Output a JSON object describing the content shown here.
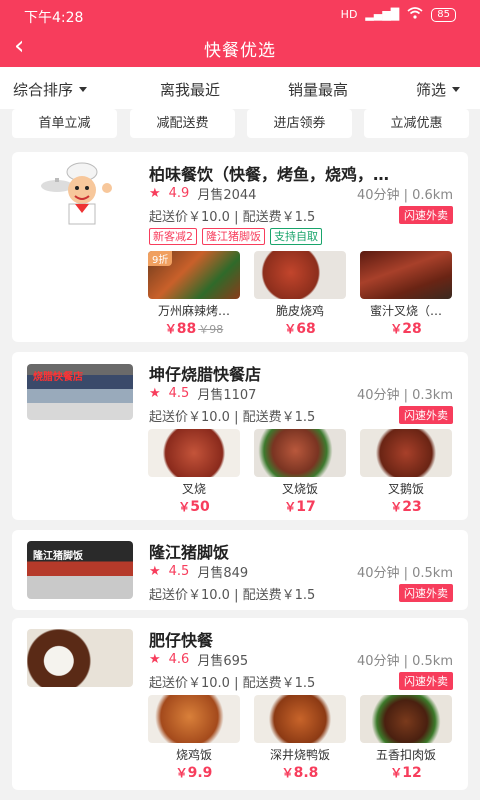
{
  "status": {
    "time": "下午4:28",
    "signal": "HD",
    "battery": "85"
  },
  "nav": {
    "title": "快餐优选"
  },
  "sort": {
    "items": [
      "综合排序",
      "离我最近",
      "销量最高",
      "筛选"
    ]
  },
  "filters": [
    "首单立减",
    "减配送费",
    "进店领券",
    "立减优惠"
  ],
  "colors": {
    "brand": "#f73d5c",
    "green": "#19a46b"
  },
  "shops": [
    {
      "name": "柏味餐饮（快餐，烤鱼，烧鸡，…",
      "rating": "4.9",
      "sales": "月售2044",
      "eta": "40分钟 | 0.6km",
      "fees": "起送价￥10.0 | 配送费￥1.5",
      "flash": "闪速外卖",
      "promos": [
        "新客减2",
        "隆江猪脚饭",
        "支持自取"
      ],
      "dishes": [
        {
          "name": "万州麻辣烤…",
          "price": "88",
          "orig": "￥98",
          "badge": "9折"
        },
        {
          "name": "脆皮烧鸡",
          "price": "68"
        },
        {
          "name": "蜜汁叉烧（…",
          "price": "28"
        }
      ]
    },
    {
      "name": "坤仔烧腊快餐店",
      "rating": "4.5",
      "sales": "月售1107",
      "eta": "40分钟 | 0.3km",
      "fees": "起送价￥10.0 | 配送费￥1.5",
      "flash": "闪速外卖",
      "dishes": [
        {
          "name": "叉烧",
          "price": "50"
        },
        {
          "name": "叉烧饭",
          "price": "17"
        },
        {
          "name": "叉鹅饭",
          "price": "23"
        }
      ]
    },
    {
      "name": "隆江猪脚饭",
      "rating": "4.5",
      "sales": "月售849",
      "eta": "40分钟 | 0.5km",
      "fees": "起送价￥10.0 | 配送费￥1.5",
      "flash": "闪速外卖"
    },
    {
      "name": "肥仔快餐",
      "rating": "4.6",
      "sales": "月售695",
      "eta": "40分钟 | 0.5km",
      "fees": "起送价￥10.0 | 配送费￥1.5",
      "flash": "闪速外卖",
      "dishes": [
        {
          "name": "烧鸡饭",
          "price": "9.9"
        },
        {
          "name": "深井烧鸭饭",
          "price": "8.8"
        },
        {
          "name": "五香扣肉饭",
          "price": "12"
        }
      ]
    }
  ],
  "currency": "￥",
  "logo_texts": {
    "shop2": "烧腊快餐店",
    "shop3": "隆江猪脚饭"
  }
}
